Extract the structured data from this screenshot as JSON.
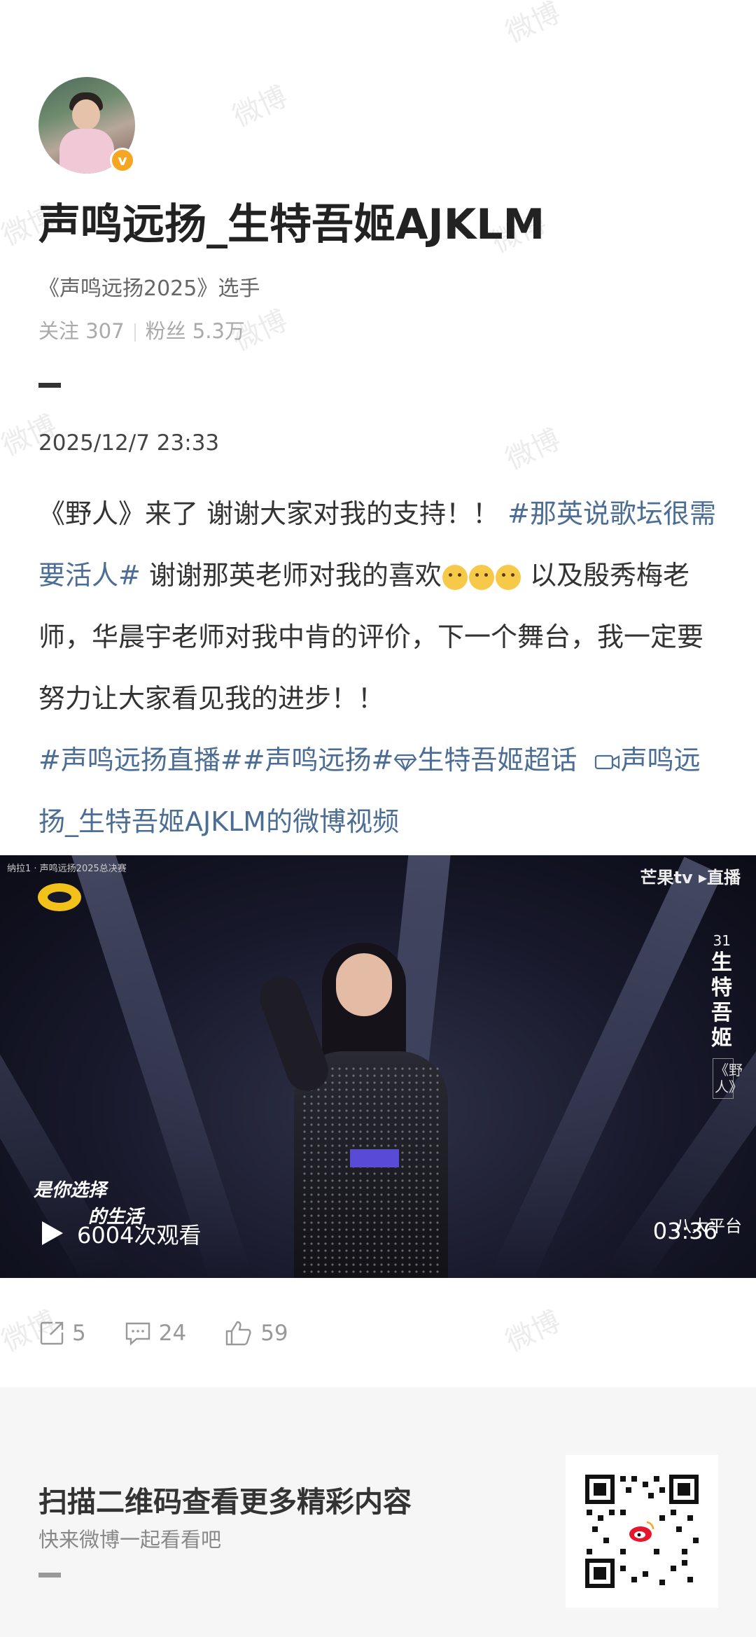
{
  "profile": {
    "name": "声鸣远扬_生特吾姬AJKLM",
    "verified_text": "《声鸣远扬2025》选手",
    "follow_label": "关注 307",
    "fans_label": "粉丝 5.3万",
    "badge": "v"
  },
  "post": {
    "date": "2025/12/7 23:33",
    "text_1": "《野人》来了 谢谢大家对我的支持！！ ",
    "tag_1": "#那英说歌坛很需要活人#",
    "text_2": " 谢谢那英老师对我的喜欢",
    "text_3": " 以及殷秀梅老师，华晨宇老师对我中肯的评价，下一个舞台，我一定要努力让大家看见我的进步！！",
    "tag_2": "#声鸣远扬直播#",
    "tag_3": "#声鸣远扬#",
    "tag_4": "生特吾姬超话",
    "video_link": "声鸣远扬_生特吾姬AJKLM的微博视频",
    "emojis": [
      "crying-emoji",
      "crying-emoji",
      "scared-emoji"
    ]
  },
  "video": {
    "episode_label": "纳拉1 · 声鸣远扬2025总决赛",
    "platform": "芒果tv ▸直播",
    "contestant_number": "31",
    "contestant_name": "生特吾姬",
    "song": "《野人》",
    "subtitle_1": "是你选择",
    "subtitle_2": "的生活",
    "channel_text": "八大平台",
    "views": "6004次观看",
    "duration": "03:36"
  },
  "actions": {
    "share_count": "5",
    "comment_count": "24",
    "like_count": "59"
  },
  "footer": {
    "title": "扫描二维码查看更多精彩内容",
    "subtitle": "快来微博一起看看吧"
  },
  "watermark": "微博",
  "colors": {
    "link": "#4c6d94",
    "badge": "#f5a623",
    "footer_bg": "#f6f6f6"
  }
}
